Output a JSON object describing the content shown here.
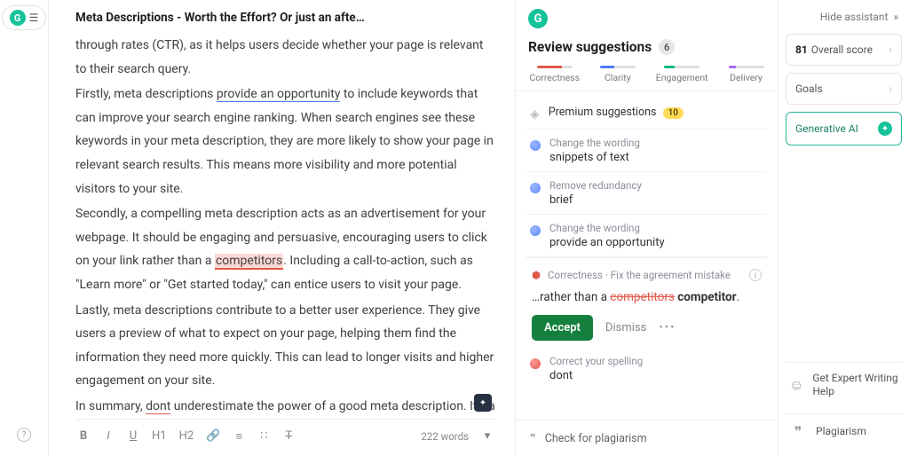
{
  "leftRail": {
    "pill": ""
  },
  "editor": {
    "title": "Meta Descriptions - Worth the Effort? Or just an afte…",
    "p1a": "through rates (CTR), as it helps users decide whether your page is relevant to their search query.",
    "p2_pre": "Firstly, meta descriptions ",
    "p2_link": "provide an opportunity",
    "p2_post": " to include keywords that can improve your search engine ranking. When search engines see these keywords in your meta description, they are more likely to show your page in relevant search results. This means more visibility and more potential visitors to your site.",
    "p3_pre": "Secondly, a compelling meta description acts as an advertisement for your webpage. It should be engaging and persuasive, encouraging users to click on your link rather than a ",
    "p3_err": "competitors",
    "p3_post": ". Including a call-to-action, such as \"Learn more\" or \"Get started today,\" can entice users to visit your page.",
    "p4": "Lastly, meta descriptions contribute to a better user experience. They give users a preview of what to expect on your page, helping them find the information they need more quickly. This can lead to longer visits and higher engagement on your site.",
    "p5_pre": "In summary, ",
    "p5_err": "dont",
    "p5_post": " underestimate the power of a good meta description. It's a small detail that can have a big impact on your website's performance.",
    "wordCount": "222 words"
  },
  "toolbar": {
    "bold": "B",
    "italic": "I",
    "underline": "U",
    "h1": "H1",
    "h2": "H2"
  },
  "suggestions": {
    "panelTitle": "Review suggestions",
    "count": "6",
    "tabs": {
      "t1": "Correctness",
      "t2": "Clarity",
      "t3": "Engagement",
      "t4": "Delivery"
    },
    "premiumLabel": "Premium suggestions",
    "premiumCount": "10",
    "items": [
      {
        "meta": "Change the wording",
        "text": "snippets of text"
      },
      {
        "meta": "Remove redundancy",
        "text": "brief"
      },
      {
        "meta": "Change the wording",
        "text": "provide an opportunity"
      }
    ],
    "focus": {
      "category": "Correctness · Fix the agreement mistake",
      "prefix": "…rather than a ",
      "wrong": "competitors",
      "right": "competitor",
      "suffix": ".",
      "accept": "Accept",
      "dismiss": "Dismiss"
    },
    "spelling": {
      "meta": "Correct your spelling",
      "text": "dont"
    },
    "plagiarism": "Check for plagiarism"
  },
  "rightRail": {
    "hide": "Hide assistant",
    "scoreNum": "81",
    "scoreLabel": "Overall score",
    "goals": "Goals",
    "genAI": "Generative AI",
    "expert": "Get Expert Writing Help",
    "plag": "Plagiarism"
  }
}
